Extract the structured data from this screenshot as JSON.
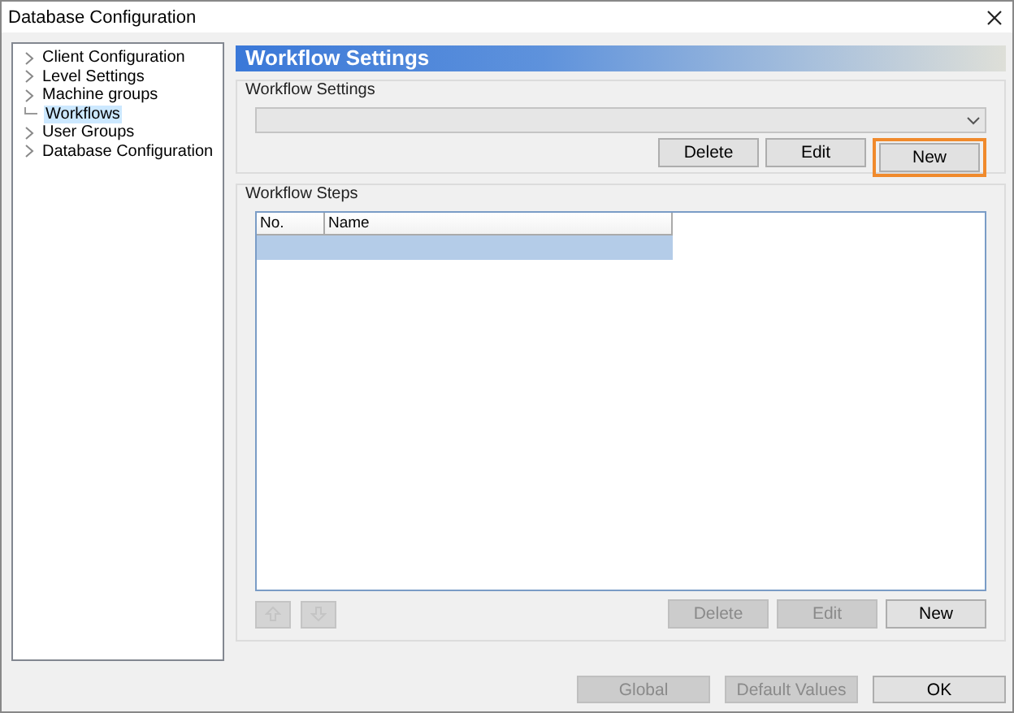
{
  "window": {
    "title": "Database Configuration"
  },
  "tree": {
    "items": [
      {
        "label": "Client Configuration",
        "expandable": true,
        "selected": false
      },
      {
        "label": "Level Settings",
        "expandable": true,
        "selected": false
      },
      {
        "label": "Machine groups",
        "expandable": true,
        "selected": false
      },
      {
        "label": "Workflows",
        "expandable": false,
        "selected": true
      },
      {
        "label": "User Groups",
        "expandable": true,
        "selected": false
      },
      {
        "label": "Database Configuration",
        "expandable": true,
        "selected": false
      }
    ]
  },
  "panel": {
    "title": "Workflow Settings",
    "settings_group": {
      "title": "Workflow Settings",
      "buttons": [
        {
          "label": "Delete",
          "disabled": false,
          "highlighted": false
        },
        {
          "label": "Edit",
          "disabled": false,
          "highlighted": false
        },
        {
          "label": "New",
          "disabled": false,
          "highlighted": true
        }
      ]
    },
    "steps_group": {
      "title": "Workflow Steps",
      "columns": [
        "No.",
        "Name"
      ],
      "rows": [
        {
          "selected": true
        }
      ],
      "move_buttons": [
        {
          "kind": "up",
          "disabled": true
        },
        {
          "kind": "down",
          "disabled": true
        }
      ],
      "buttons": [
        {
          "label": "Delete",
          "disabled": true
        },
        {
          "label": "Edit",
          "disabled": true
        },
        {
          "label": "New",
          "disabled": false
        }
      ]
    }
  },
  "footer_buttons": [
    {
      "label": "Global",
      "disabled": true
    },
    {
      "label": "Default Values",
      "disabled": true
    },
    {
      "label": "OK",
      "disabled": false
    }
  ]
}
